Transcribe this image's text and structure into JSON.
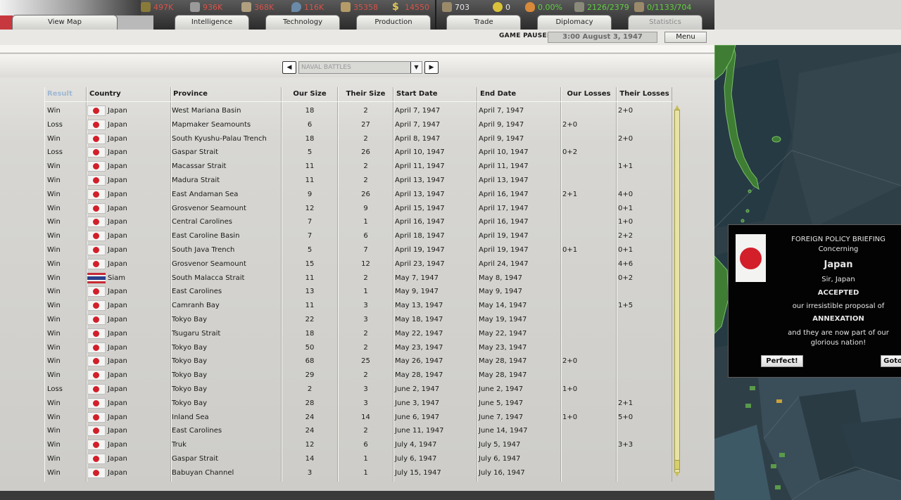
{
  "resources": {
    "energy": "497K",
    "metal": "936K",
    "rare_materials": "368K",
    "oil": "116K",
    "supplies": "35358",
    "money": "14550",
    "manpower": "703",
    "nukes": "0",
    "dissent": "0.00%",
    "transports": "2126/2379",
    "escorts": "0/1133/704"
  },
  "tabs": {
    "view_map": "View Map",
    "intelligence": "Intelligence",
    "technology": "Technology",
    "production": "Production",
    "trade": "Trade",
    "diplomacy": "Diplomacy",
    "statistics": "Statistics"
  },
  "status": {
    "paused": "GAME PAUSED",
    "date": "3:00 August 3, 1947",
    "menu": "Menu"
  },
  "selector": {
    "prev": "◀",
    "next": "▶",
    "value": "NAVAL BATTLES",
    "arrow": "▼"
  },
  "table": {
    "headers": [
      "Result",
      "Country",
      "Province",
      "Our Size",
      "Their Size",
      "Start Date",
      "End Date",
      "Our Losses",
      "Their Losses"
    ],
    "rows": [
      [
        "Win",
        "Japan",
        "West Mariana Basin",
        "18",
        "2",
        "April 7, 1947",
        "April 7, 1947",
        "",
        "2+0"
      ],
      [
        "Loss",
        "Japan",
        "Mapmaker Seamounts",
        "6",
        "27",
        "April 7, 1947",
        "April 9, 1947",
        "2+0",
        ""
      ],
      [
        "Win",
        "Japan",
        "South Kyushu-Palau Trench",
        "18",
        "2",
        "April 8, 1947",
        "April 9, 1947",
        "",
        "2+0"
      ],
      [
        "Loss",
        "Japan",
        "Gaspar Strait",
        "5",
        "26",
        "April 10, 1947",
        "April 10, 1947",
        "0+2",
        ""
      ],
      [
        "Win",
        "Japan",
        "Macassar Strait",
        "11",
        "2",
        "April 11, 1947",
        "April 11, 1947",
        "",
        "1+1"
      ],
      [
        "Win",
        "Japan",
        "Madura Strait",
        "11",
        "2",
        "April 13, 1947",
        "April 13, 1947",
        "",
        ""
      ],
      [
        "Win",
        "Japan",
        "East Andaman Sea",
        "9",
        "26",
        "April 13, 1947",
        "April 16, 1947",
        "2+1",
        "4+0"
      ],
      [
        "Win",
        "Japan",
        "Grosvenor Seamount",
        "12",
        "9",
        "April 15, 1947",
        "April 17, 1947",
        "",
        "0+1"
      ],
      [
        "Win",
        "Japan",
        "Central Carolines",
        "7",
        "1",
        "April 16, 1947",
        "April 16, 1947",
        "",
        "1+0"
      ],
      [
        "Win",
        "Japan",
        "East Caroline Basin",
        "7",
        "6",
        "April 18, 1947",
        "April 19, 1947",
        "",
        "2+2"
      ],
      [
        "Win",
        "Japan",
        "South Java Trench",
        "5",
        "7",
        "April 19, 1947",
        "April 19, 1947",
        "0+1",
        "0+1"
      ],
      [
        "Win",
        "Japan",
        "Grosvenor Seamount",
        "15",
        "12",
        "April 23, 1947",
        "April 24, 1947",
        "",
        "4+6"
      ],
      [
        "Win",
        "Siam",
        "South Malacca Strait",
        "11",
        "2",
        "May 7, 1947",
        "May 8, 1947",
        "",
        "0+2"
      ],
      [
        "Win",
        "Japan",
        "East Carolines",
        "13",
        "1",
        "May 9, 1947",
        "May 9, 1947",
        "",
        ""
      ],
      [
        "Win",
        "Japan",
        "Camranh Bay",
        "11",
        "3",
        "May 13, 1947",
        "May 14, 1947",
        "",
        "1+5"
      ],
      [
        "Win",
        "Japan",
        "Tokyo Bay",
        "22",
        "3",
        "May 18, 1947",
        "May 19, 1947",
        "",
        ""
      ],
      [
        "Win",
        "Japan",
        "Tsugaru Strait",
        "18",
        "2",
        "May 22, 1947",
        "May 22, 1947",
        "",
        ""
      ],
      [
        "Win",
        "Japan",
        "Tokyo Bay",
        "50",
        "2",
        "May 23, 1947",
        "May 23, 1947",
        "",
        ""
      ],
      [
        "Win",
        "Japan",
        "Tokyo Bay",
        "68",
        "25",
        "May 26, 1947",
        "May 28, 1947",
        "2+0",
        ""
      ],
      [
        "Win",
        "Japan",
        "Tokyo Bay",
        "29",
        "2",
        "May 28, 1947",
        "May 28, 1947",
        "",
        ""
      ],
      [
        "Loss",
        "Japan",
        "Tokyo Bay",
        "2",
        "3",
        "June 2, 1947",
        "June 2, 1947",
        "1+0",
        ""
      ],
      [
        "Win",
        "Japan",
        "Tokyo Bay",
        "28",
        "3",
        "June 3, 1947",
        "June 5, 1947",
        "",
        "2+1"
      ],
      [
        "Win",
        "Japan",
        "Inland Sea",
        "24",
        "14",
        "June 6, 1947",
        "June 7, 1947",
        "1+0",
        "5+0"
      ],
      [
        "Win",
        "Japan",
        "East Carolines",
        "24",
        "2",
        "June 11, 1947",
        "June 14, 1947",
        "",
        ""
      ],
      [
        "Win",
        "Japan",
        "Truk",
        "12",
        "6",
        "July 4, 1947",
        "July 5, 1947",
        "",
        "3+3"
      ],
      [
        "Win",
        "Japan",
        "Gaspar Strait",
        "14",
        "1",
        "July 6, 1947",
        "July 6, 1947",
        "",
        ""
      ],
      [
        "Win",
        "Japan",
        "Babuyan Channel",
        "3",
        "1",
        "July 15, 1947",
        "July 16, 1947",
        "",
        ""
      ]
    ]
  },
  "briefing": {
    "title": "FOREIGN POLICY BRIEFING",
    "concerning": "Concerning",
    "country": "Japan",
    "salutation": "Sir, Japan",
    "verdict": "ACCEPTED",
    "line1": "our irresistible proposal of",
    "proposal": "ANNEXATION",
    "line2": "and they are now part of our",
    "line3": "glorious nation!",
    "btn_ok": "Perfect!",
    "btn_goto": "Goto"
  },
  "colors": {
    "japan_red": "#d21f2a",
    "territory_green": "#3e7d33",
    "sea": "#2f3f48"
  }
}
